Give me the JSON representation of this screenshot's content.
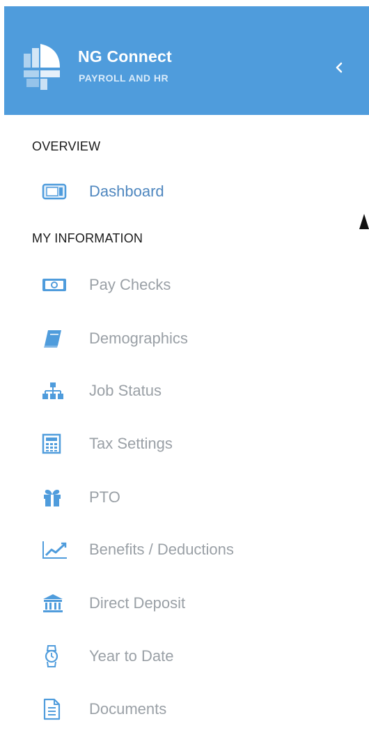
{
  "header": {
    "title": "NG Connect",
    "subtitle": "PAYROLL AND HR",
    "brand_color": "#4f9cdc",
    "collapse_icon": "chevron-left-icon"
  },
  "sections": [
    {
      "label": "OVERVIEW",
      "items": [
        {
          "label": "Dashboard",
          "icon": "dashboard-icon",
          "active": true
        }
      ]
    },
    {
      "label": "MY INFORMATION",
      "items": [
        {
          "label": "Pay Checks",
          "icon": "money-icon"
        },
        {
          "label": "Demographics",
          "icon": "book-icon"
        },
        {
          "label": "Job Status",
          "icon": "org-chart-icon"
        },
        {
          "label": "Tax Settings",
          "icon": "calculator-icon"
        },
        {
          "label": "PTO",
          "icon": "gift-icon"
        },
        {
          "label": "Benefits / Deductions",
          "icon": "line-chart-icon"
        },
        {
          "label": "Direct Deposit",
          "icon": "bank-icon"
        },
        {
          "label": "Year to Date",
          "icon": "watch-icon"
        },
        {
          "label": "Documents",
          "icon": "document-icon"
        }
      ]
    }
  ],
  "colors": {
    "icon": "#4f9cdc",
    "active_text": "#4f87bf",
    "inactive_text": "#9aa0a6"
  }
}
